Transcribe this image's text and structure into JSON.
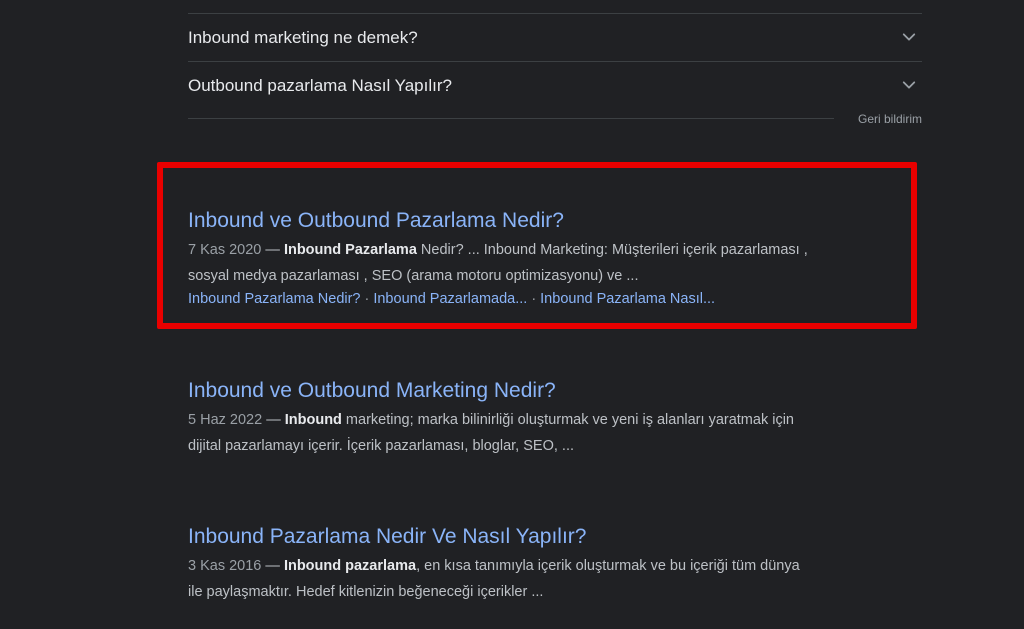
{
  "people_also_ask": {
    "questions": [
      "Inbound marketing ne demek?",
      "Outbound pazarlama Nasıl Yapılır?"
    ],
    "feedback_label": "Geri bildirim"
  },
  "results": [
    {
      "title": "Inbound ve Outbound Pazarlama Nedir?",
      "date": "7 Kas 2020",
      "separator": " — ",
      "bold1": "Inbound Pazarlama",
      "text1": " Nedir? ... Inbound Marketing: Müşterileri içerik pazarlaması ,",
      "line2": "sosyal medya pazarlaması , SEO (arama motoru optimizasyonu) ve ...",
      "sitelinks": [
        "Inbound Pazarlama Nedir?",
        "Inbound Pazarlamada...",
        "Inbound Pazarlama Nasıl..."
      ],
      "link_dot": "·",
      "highlighted": true
    },
    {
      "title": "Inbound ve Outbound Marketing Nedir?",
      "date": "5 Haz 2022",
      "separator": " — ",
      "bold1": "Inbound",
      "text1": " marketing; marka bilinirliği oluşturmak ve yeni iş alanları yaratmak için",
      "line2": "dijital pazarlamayı içerir. İçerik pazarlaması, bloglar, SEO, ..."
    },
    {
      "title": "Inbound Pazarlama Nedir Ve Nasıl Yapılır?",
      "date": "3 Kas 2016",
      "separator": " — ",
      "bold1": "Inbound pazarlama",
      "text1": ", en kısa tanımıyla içerik oluşturmak ve bu içeriği tüm dünya",
      "line2": "ile paylaşmaktır. Hedef kitlenizin beğeneceği içerikler ..."
    }
  ],
  "colors": {
    "background": "#202124",
    "link": "#8ab4f8",
    "highlight_border": "#e90000"
  }
}
